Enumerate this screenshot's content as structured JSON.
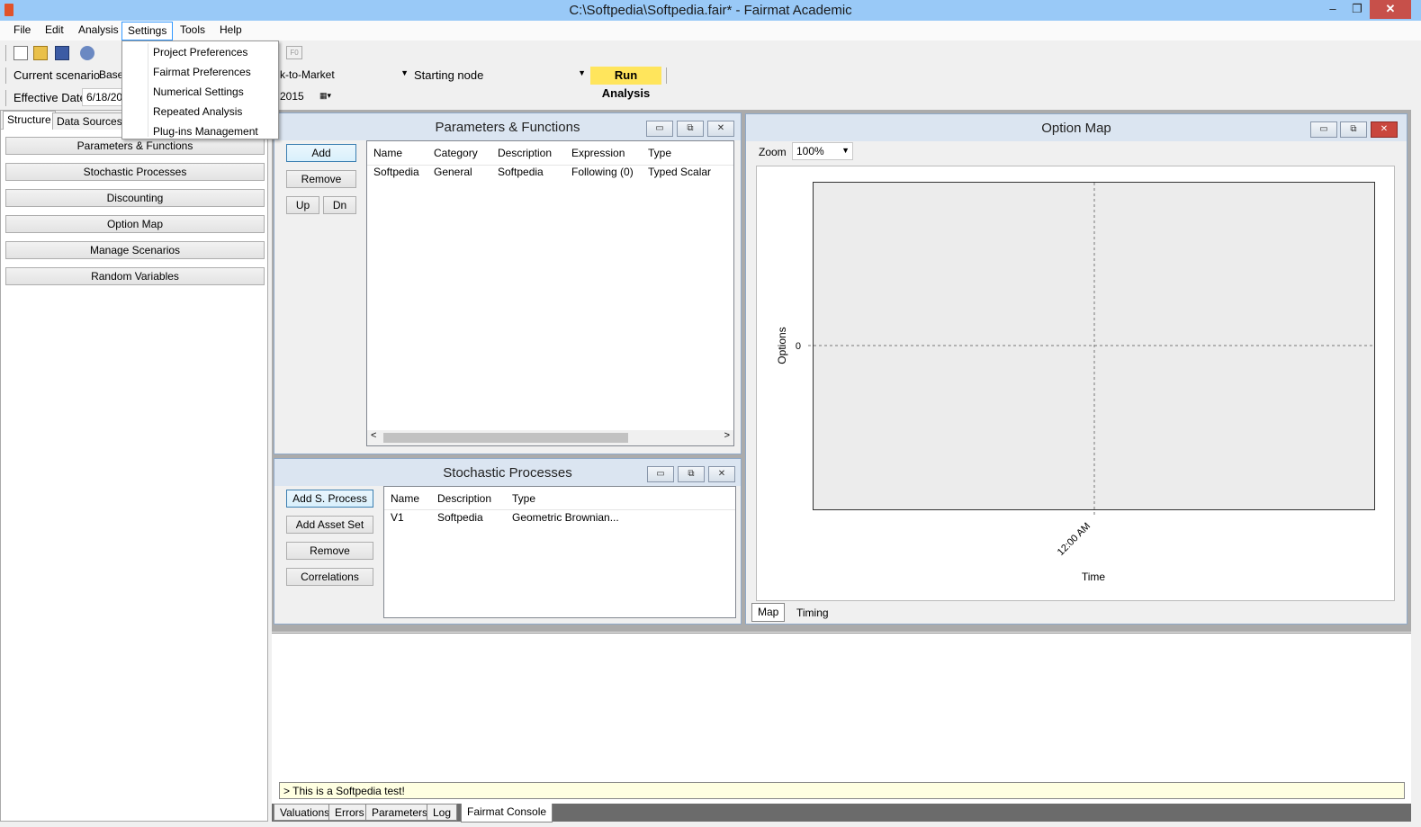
{
  "window": {
    "title": "C:\\Softpedia\\Softpedia.fair* - Fairmat Academic",
    "min_label": "–",
    "max_label": "❐",
    "close_label": "✕"
  },
  "menubar": {
    "items": [
      "File",
      "Edit",
      "Analysis",
      "Settings",
      "Tools",
      "Help"
    ]
  },
  "settings_menu": {
    "items": [
      "Project Preferences",
      "Fairmat Preferences",
      "Numerical Settings",
      "Repeated Analysis",
      "Plug-ins Management"
    ]
  },
  "toolbar": {
    "fx_label": "F0",
    "current_scenario_label": "Current scenario",
    "scenario_value": "Base",
    "valuation_value": "k-to-Market",
    "starting_node_label": "Starting node",
    "starting_node_value": "",
    "run_label": "Run Analysis",
    "effective_date_label": "Effective Date",
    "effective_date_value": "6/18/20",
    "end_date_value": "2015"
  },
  "left_panel": {
    "tabs": [
      "Structure",
      "Data Sources"
    ],
    "buttons": [
      "Parameters & Functions",
      "Stochastic Processes",
      "Discounting",
      "Option Map",
      "Manage Scenarios",
      "Random Variables"
    ]
  },
  "params_window": {
    "title": "Parameters & Functions",
    "buttons": {
      "add": "Add",
      "remove": "Remove",
      "up": "Up",
      "dn": "Dn"
    },
    "columns": [
      "Name",
      "Category",
      "Description",
      "Expression",
      "Type"
    ],
    "rows": [
      [
        "Softpedia",
        "General",
        "Softpedia",
        "Following (0)",
        "Typed Scalar"
      ]
    ]
  },
  "stoch_window": {
    "title": "Stochastic Processes",
    "buttons": {
      "add_process": "Add S. Process",
      "add_asset_set": "Add Asset Set",
      "remove": "Remove",
      "correlations": "Correlations"
    },
    "columns": [
      "Name",
      "Description",
      "Type"
    ],
    "rows": [
      [
        "V1",
        "Softpedia",
        "Geometric Brownian..."
      ]
    ]
  },
  "option_map": {
    "title": "Option Map",
    "zoom_label": "Zoom",
    "zoom_value": "100%",
    "tabs": [
      "Map",
      "Timing"
    ]
  },
  "chart_data": {
    "type": "line",
    "title": "",
    "xlabel": "Time",
    "ylabel": "Options",
    "x_ticks": [
      "12:00 AM"
    ],
    "y_ticks": [
      "0"
    ],
    "grid": true,
    "series": []
  },
  "console": {
    "line": "> This is a Softpedia test!",
    "tabs": [
      "Valuations",
      "Errors",
      "Parameters",
      "Log",
      "Fairmat Console"
    ]
  }
}
